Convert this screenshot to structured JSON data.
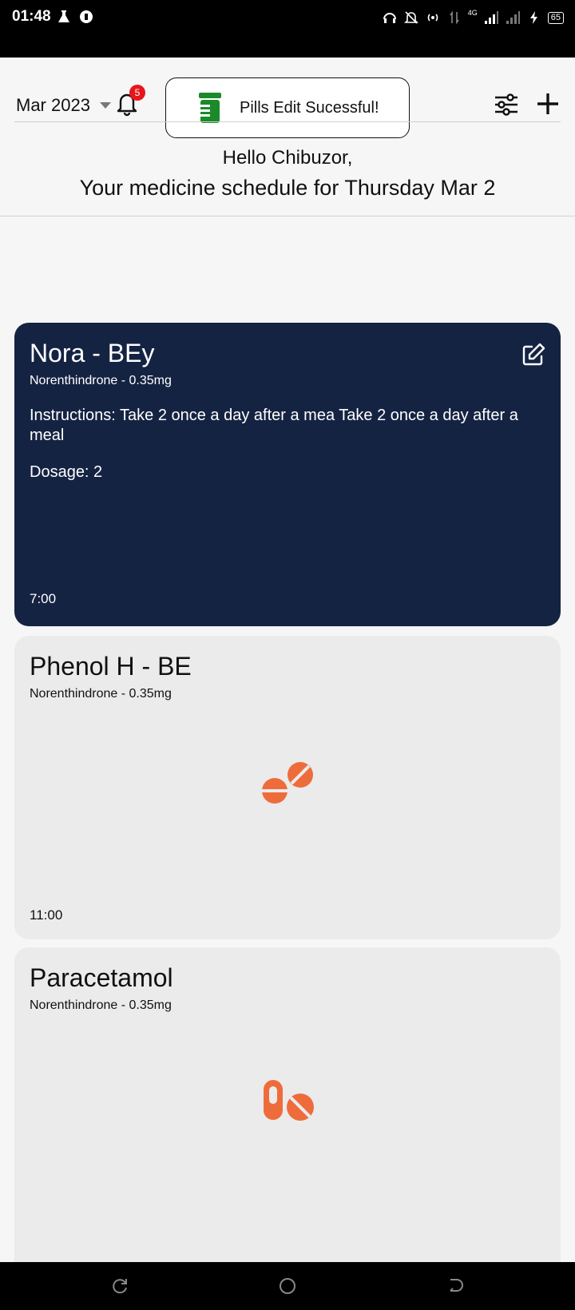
{
  "status_bar": {
    "time": "01:48",
    "network_label": "4G",
    "battery": "65"
  },
  "header": {
    "month": "Mar 2023",
    "notification_count": "5",
    "toast_message": "Pills Edit Sucessful!"
  },
  "greeting": {
    "line1": "Hello Chibuzor,",
    "line2": "Your medicine schedule for Thursday Mar 2"
  },
  "medicines": [
    {
      "name": "Nora - BEy",
      "subtitle": "Norenthindrone - 0.35mg",
      "instructions": "Instructions: Take 2 once a day after a mea Take 2 once a day after a meal",
      "dosage": "Dosage: 2",
      "time": "7:00"
    },
    {
      "name": "Phenol H - BE",
      "subtitle": "Norenthindrone - 0.35mg",
      "time": "11:00"
    },
    {
      "name": "Paracetamol",
      "subtitle": "Norenthindrone - 0.35mg"
    }
  ],
  "colors": {
    "active_card": "#152343",
    "inactive_card": "#ebebeb",
    "pill_orange": "#ee6c3c",
    "toast_icon_green": "#1a8a2a",
    "badge_red": "#e8161c"
  },
  "icons": [
    "bell-icon",
    "pill-bottle-icon",
    "sliders-icon",
    "plus-icon",
    "edit-icon",
    "tablets-icon",
    "capsule-tablet-icon",
    "recent-apps-icon",
    "home-icon",
    "back-icon"
  ]
}
